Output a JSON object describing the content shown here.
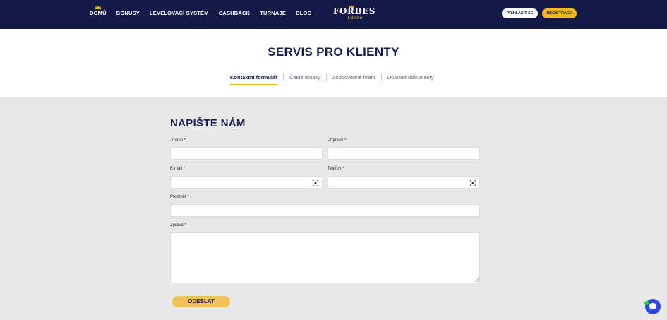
{
  "header": {
    "nav": [
      {
        "label": "DOMŮ"
      },
      {
        "label": "BONUSY"
      },
      {
        "label": "LEVELOVACÍ SYSTÉM"
      },
      {
        "label": "CASHBACK"
      },
      {
        "label": "TURNAJE"
      },
      {
        "label": "BLOG"
      }
    ],
    "logo": {
      "main": "FORBES",
      "sub": "Casino"
    },
    "login_label": "PŘIHLÁSIT SE",
    "register_label": "REGISTRACE"
  },
  "page": {
    "title": "SERVIS PRO KLIENTY",
    "tabs": [
      {
        "label": "Kontaktní formulář",
        "active": true
      },
      {
        "label": "Časté dotazy"
      },
      {
        "label": "Zodpovědné hraní"
      },
      {
        "label": "Důležité dokumenty"
      }
    ]
  },
  "form": {
    "title": "NAPIŠTE NÁM",
    "first_name": {
      "label": "Jméno *",
      "value": ""
    },
    "last_name": {
      "label": "Příjmení *",
      "value": ""
    },
    "email": {
      "label": "E-mail *",
      "value": ""
    },
    "phone": {
      "label": "Telefon *",
      "value": ""
    },
    "subject": {
      "label": "Předmět *",
      "value": ""
    },
    "message": {
      "label": "Zpráva *",
      "value": ""
    },
    "submit_label": "ODESLAT"
  },
  "colors": {
    "header_bg": "#141a48",
    "accent": "#f2b51e",
    "title": "#1a1f4d",
    "chat": "#2f49e0"
  }
}
